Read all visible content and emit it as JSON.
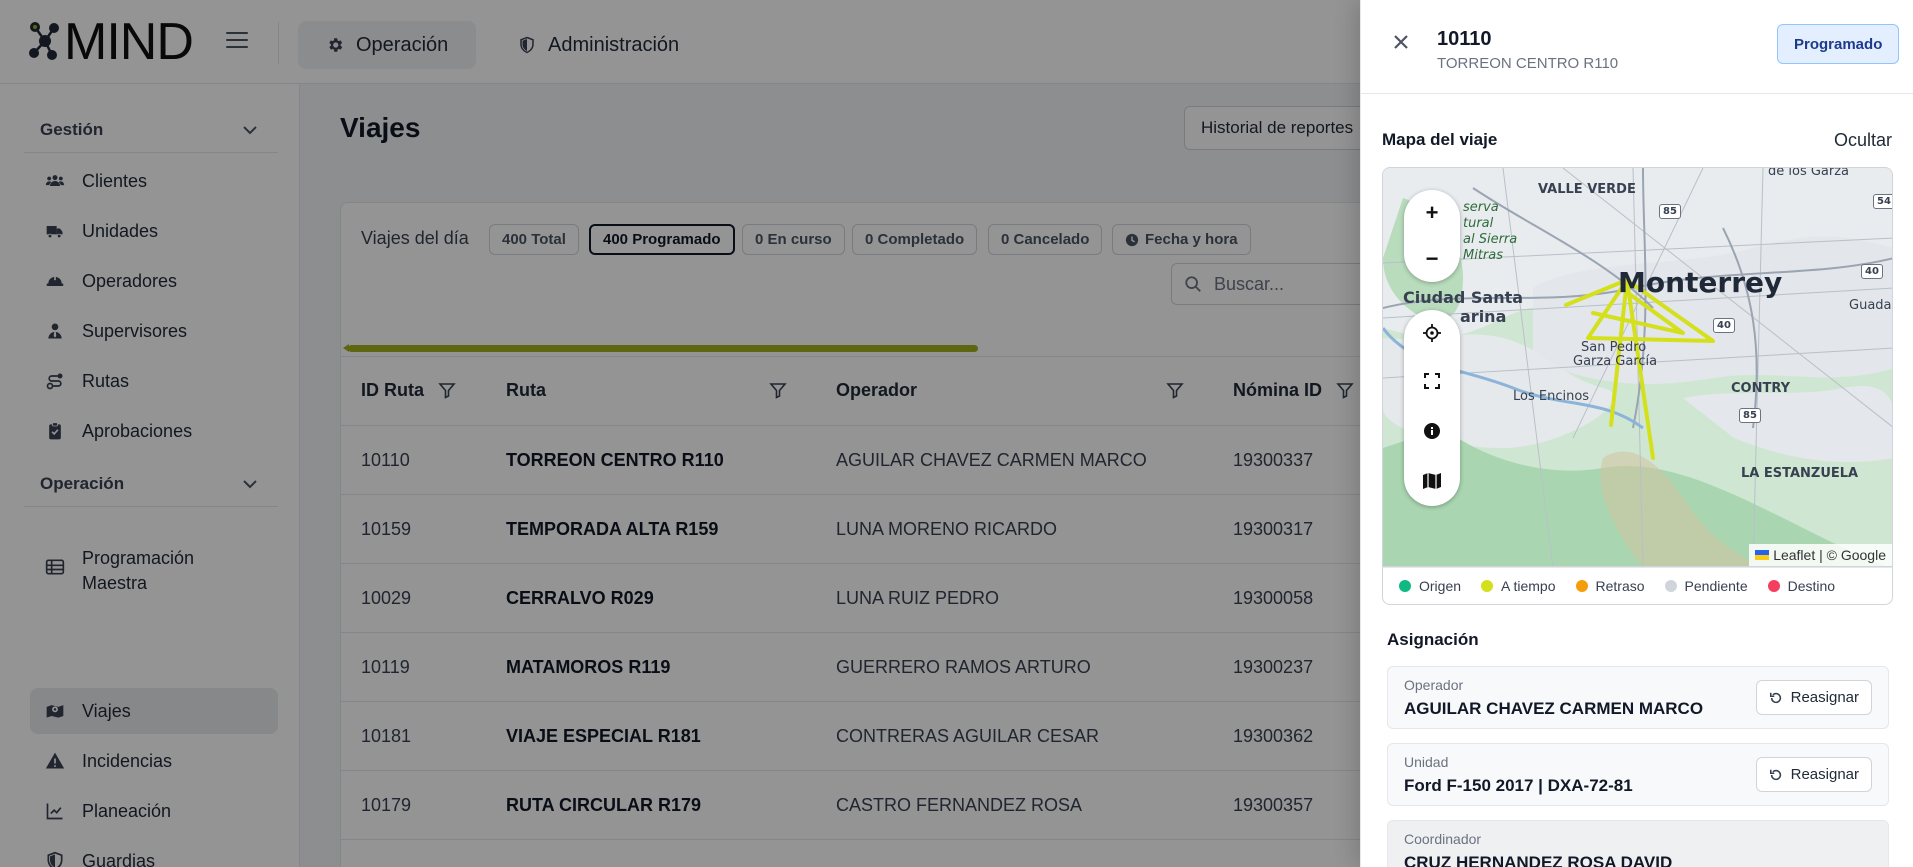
{
  "app": {
    "logo_text": "MIND"
  },
  "topnav": {
    "tabs": [
      {
        "label": "Operación",
        "icon": "gear-icon",
        "active": true
      },
      {
        "label": "Administración",
        "icon": "shield-icon",
        "active": false
      }
    ]
  },
  "sidebar": {
    "sections": [
      {
        "title": "Gestión",
        "items": [
          {
            "label": "Clientes",
            "icon": "users-icon"
          },
          {
            "label": "Unidades",
            "icon": "truck-icon"
          },
          {
            "label": "Operadores",
            "icon": "hardhat-icon"
          },
          {
            "label": "Supervisores",
            "icon": "user-tie-icon"
          },
          {
            "label": "Rutas",
            "icon": "route-icon"
          },
          {
            "label": "Aprobaciones",
            "icon": "clipboard-check-icon"
          }
        ]
      },
      {
        "title": "Operación",
        "items": [
          {
            "label": "Programación Maestra",
            "icon": "table-list-icon"
          },
          {
            "label": "Viajes",
            "icon": "map-location-icon",
            "active": true
          },
          {
            "label": "Incidencias",
            "icon": "warning-icon"
          },
          {
            "label": "Planeación",
            "icon": "chart-icon"
          },
          {
            "label": "Guardias",
            "icon": "shield-half-icon"
          }
        ]
      }
    ]
  },
  "page": {
    "title": "Viajes",
    "history_button": "Historial de reportes"
  },
  "trips": {
    "day_label": "Viajes del día",
    "chips": [
      {
        "label": "400 Total",
        "selected": false
      },
      {
        "label": "400 Programado",
        "selected": true
      },
      {
        "label": "0 En curso",
        "selected": false
      },
      {
        "label": "0 Completado",
        "selected": false
      },
      {
        "label": "0 Cancelado",
        "selected": false
      },
      {
        "label": "Fecha y hora",
        "selected": false,
        "icon": "clock-icon"
      }
    ],
    "search_placeholder": "Buscar...",
    "columns": [
      "ID Ruta",
      "Ruta",
      "Operador",
      "Nómina ID"
    ],
    "rows": [
      {
        "id": "10110",
        "route": "TORREON CENTRO R110",
        "operator": "AGUILAR CHAVEZ CARMEN MARCO",
        "payroll": "19300337"
      },
      {
        "id": "10159",
        "route": "TEMPORADA ALTA R159",
        "operator": "LUNA MORENO RICARDO",
        "payroll": "19300317"
      },
      {
        "id": "10029",
        "route": "CERRALVO R029",
        "operator": "LUNA RUIZ PEDRO",
        "payroll": "19300058"
      },
      {
        "id": "10119",
        "route": "MATAMOROS R119",
        "operator": "GUERRERO RAMOS ARTURO",
        "payroll": "19300237"
      },
      {
        "id": "10181",
        "route": "VIAJE ESPECIAL R181",
        "operator": "CONTRERAS AGUILAR CESAR",
        "payroll": "19300362"
      },
      {
        "id": "10179",
        "route": "RUTA CIRCULAR R179",
        "operator": "CASTRO FERNANDEZ ROSA",
        "payroll": "19300357"
      }
    ]
  },
  "drawer": {
    "id": "10110",
    "subtitle": "TORREON CENTRO R110",
    "status": "Programado",
    "map_title": "Mapa del viaje",
    "map_toggle": "Ocultar",
    "map_labels": {
      "valle_verde": "VALLE VERDE",
      "de_los_garza": "de los Garza",
      "reserva": "serva",
      "natural": "tural",
      "sierra": "al Sierra",
      "mitras": "Mitras",
      "monterrey": "Monterrey",
      "ciudad_santa": "Ciudad Santa",
      "catarina": "arina",
      "guadalupe": "Guadalu",
      "san_pedro": "San Pedro",
      "garza_garcia": "Garza García",
      "los_encinos": "Los Encinos",
      "contry": "CONTRY",
      "la_estanzuela": "LA ESTANZUELA",
      "hw_85a": "85",
      "hw_85b": "85",
      "hw_40a": "40",
      "hw_40b": "40",
      "hw_54": "54"
    },
    "attribution": "Leaflet | © Google",
    "legend": [
      {
        "label": "Origen",
        "color": "#10b981"
      },
      {
        "label": "A tiempo",
        "color": "#d4e01c"
      },
      {
        "label": "Retraso",
        "color": "#f59e0b"
      },
      {
        "label": "Pendiente",
        "color": "#d1d5db"
      },
      {
        "label": "Destino",
        "color": "#f43f5e"
      }
    ],
    "assignment_title": "Asignación",
    "assignment": [
      {
        "label": "Operador",
        "value": "AGUILAR CHAVEZ CARMEN MARCO",
        "action": "Reasignar"
      },
      {
        "label": "Unidad",
        "value": "Ford F-150 2017 | DXA-72-81",
        "action": "Reasignar"
      },
      {
        "label": "Coordinador",
        "value": "CRUZ HERNANDEZ ROSA DAVID"
      }
    ]
  }
}
